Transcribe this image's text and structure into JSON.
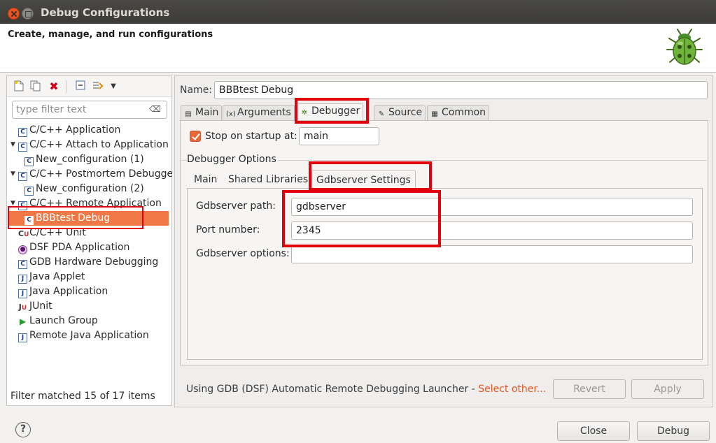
{
  "window": {
    "title": "Debug Configurations"
  },
  "header": {
    "text": "Create, manage, and run configurations",
    "icon": "bug-icon"
  },
  "left": {
    "filter_placeholder": "type filter text",
    "tree": [
      {
        "label": "C/C++ Application",
        "icon": "c-config-icon"
      },
      {
        "label": "C/C++ Attach to Application",
        "icon": "c-config-icon",
        "expanded": true
      },
      {
        "label": "New_configuration (1)",
        "icon": "c-config-icon"
      },
      {
        "label": "C/C++ Postmortem Debugger",
        "icon": "c-config-icon",
        "expanded": true
      },
      {
        "label": "New_configuration (2)",
        "icon": "c-config-icon"
      },
      {
        "label": "C/C++ Remote Application",
        "icon": "c-config-icon",
        "expanded": true
      },
      {
        "label": "BBBtest Debug",
        "icon": "c-config-icon",
        "selected": true
      },
      {
        "label": "C/C++ Unit",
        "icon": "cunit-icon"
      },
      {
        "label": "DSF PDA Application",
        "icon": "pda-icon"
      },
      {
        "label": "GDB Hardware Debugging",
        "icon": "c-config-icon"
      },
      {
        "label": "Java Applet",
        "icon": "java-applet-icon"
      },
      {
        "label": "Java Application",
        "icon": "java-app-icon"
      },
      {
        "label": "JUnit",
        "icon": "junit-icon"
      },
      {
        "label": "Launch Group",
        "icon": "launch-group-icon"
      },
      {
        "label": "Remote Java Application",
        "icon": "remote-java-icon"
      }
    ],
    "filter_status": "Filter matched 15 of 17 items"
  },
  "right": {
    "name_label": "Name:",
    "name_value": "BBBtest Debug",
    "tabs": [
      "Main",
      "Arguments",
      "Debugger",
      "Source",
      "Common"
    ],
    "active_tab": "Debugger",
    "stop_on_startup_label": "Stop on startup at:",
    "stop_on_startup_checked": true,
    "stop_on_startup_value": "main",
    "debugger_options_label": "Debugger Options",
    "sub_tabs": [
      "Main",
      "Shared Libraries",
      "Gdbserver Settings"
    ],
    "active_sub_tab": "Gdbserver Settings",
    "gdbserver_path_label": "Gdbserver path:",
    "gdbserver_path_value": "gdbserver",
    "port_number_label": "Port number:",
    "port_number_value": "2345",
    "gdbserver_options_label": "Gdbserver options:",
    "gdbserver_options_value": "",
    "launcher_text": "Using GDB (DSF) Automatic Remote Debugging Launcher - ",
    "launcher_link": "Select other...",
    "revert_label": "Revert",
    "apply_label": "Apply"
  },
  "footer": {
    "close_label": "Close",
    "debug_label": "Debug",
    "help_label": "?"
  },
  "colors": {
    "accent": "#e95420",
    "selection": "#f07746",
    "annotation": "#e2000c"
  }
}
